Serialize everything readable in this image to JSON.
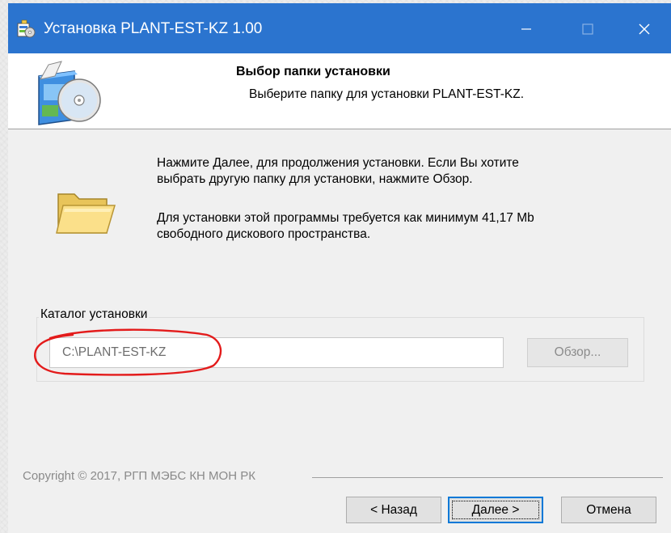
{
  "window": {
    "title": "Установка PLANT-EST-KZ 1.00",
    "accent_color": "#2b74cf",
    "icons": {
      "app": "installer-package-icon",
      "minimize": "minimize-icon",
      "maximize": "maximize-icon",
      "close": "close-icon"
    }
  },
  "header": {
    "title": "Выбор папки установки",
    "subtitle": "Выберите папку для установки PLANT-EST-KZ.",
    "icon": "install-disc-box-icon"
  },
  "body": {
    "icon": "folder-icon",
    "description": [
      "Нажмите Далее, для продолжения установки. Если Вы хотите",
      "выбрать другую папку для установки, нажмите Обзор.",
      "Для установки этой программы требуется как минимум 41,17 Mb",
      "свободного дискового пространства."
    ]
  },
  "install_dir": {
    "group_label": "Каталог установки",
    "path_value": "C:\\PLANT-EST-KZ",
    "browse_label": "Обзор...",
    "highlight_color": "#e31b1b"
  },
  "footer": {
    "copyright": "Copyright © 2017, РГП МЭБС КН МОН РК",
    "back_label": "< Назад",
    "next_label": "Далее >",
    "cancel_label": "Отмена"
  }
}
